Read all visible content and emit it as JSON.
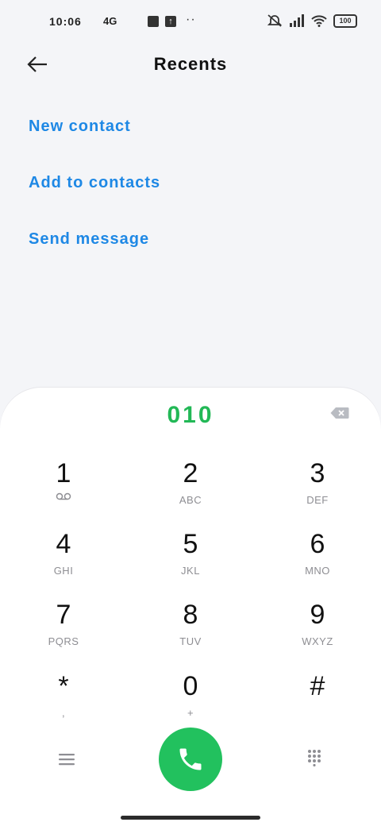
{
  "status": {
    "time": "10:06",
    "network": "4G",
    "up_arrow": "↑",
    "dots": "··",
    "battery": "100"
  },
  "header": {
    "title": "Recents"
  },
  "options": [
    {
      "label": "New contact"
    },
    {
      "label": "Add to contacts"
    },
    {
      "label": "Send message"
    }
  ],
  "dialer": {
    "number": "010",
    "keys": [
      {
        "digit": "1",
        "letters": ""
      },
      {
        "digit": "2",
        "letters": "ABC"
      },
      {
        "digit": "3",
        "letters": "DEF"
      },
      {
        "digit": "4",
        "letters": "GHI"
      },
      {
        "digit": "5",
        "letters": "JKL"
      },
      {
        "digit": "6",
        "letters": "MNO"
      },
      {
        "digit": "7",
        "letters": "PQRS"
      },
      {
        "digit": "8",
        "letters": "TUV"
      },
      {
        "digit": "9",
        "letters": "WXYZ"
      },
      {
        "digit": "*",
        "letters": ","
      },
      {
        "digit": "0",
        "letters": "+"
      },
      {
        "digit": "#",
        "letters": ""
      }
    ]
  },
  "icons": {
    "back": "arrow-left-icon",
    "backspace": "backspace-icon",
    "voicemail": "voicemail-icon",
    "menu": "menu-icon",
    "call": "phone-icon",
    "keypad": "keypad-icon"
  },
  "colors": {
    "accent_blue": "#1e88e5",
    "accent_green": "#22c15e",
    "background": "#f4f5f8"
  }
}
